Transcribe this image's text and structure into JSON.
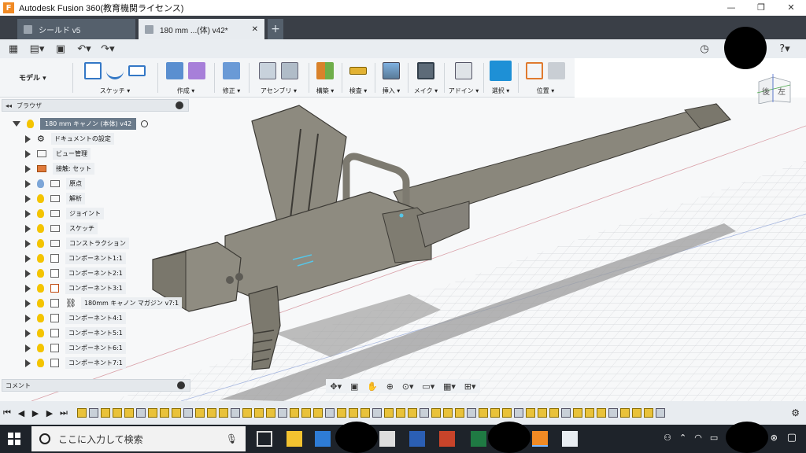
{
  "window": {
    "title": "Autodesk Fusion 360(教育機関ライセンス)",
    "controls": [
      "—",
      "❐",
      "✕"
    ]
  },
  "tabs": [
    {
      "label": "シールド v5",
      "active": false
    },
    {
      "label": "180 mm ...(体) v42*",
      "active": true
    }
  ],
  "tab_close": "✕",
  "tab_add": "+",
  "ribbon": {
    "workspace": "モデル ▾",
    "groups": [
      {
        "label": "スケッチ ▾"
      },
      {
        "label": "作成 ▾"
      },
      {
        "label": "修正 ▾"
      },
      {
        "label": "アセンブリ ▾"
      },
      {
        "label": "構築 ▾"
      },
      {
        "label": "検査 ▾"
      },
      {
        "label": "挿入 ▾"
      },
      {
        "label": "メイク ▾"
      },
      {
        "label": "アドイン ▾"
      },
      {
        "label": "選択 ▾"
      },
      {
        "label": "位置 ▾"
      }
    ]
  },
  "viewcube": {
    "left_face": "後",
    "right_face": "左"
  },
  "browser": {
    "title": "ブラウザ",
    "root": "180 mm キャノン (本体) v42",
    "items": [
      {
        "label": "ドキュメントの設定",
        "type": "gear"
      },
      {
        "label": "ビュー管理",
        "type": "folder"
      },
      {
        "label": "接触: セット",
        "type": "contact"
      },
      {
        "label": "原点",
        "type": "folder"
      },
      {
        "label": "解析",
        "type": "folder"
      },
      {
        "label": "ジョイント",
        "type": "folder"
      },
      {
        "label": "スケッチ",
        "type": "folder"
      },
      {
        "label": "コンストラクション",
        "type": "folder"
      },
      {
        "label": "コンポーネント1:1",
        "type": "component"
      },
      {
        "label": "コンポーネント2:1",
        "type": "component"
      },
      {
        "label": "コンポーネント3:1",
        "type": "component"
      },
      {
        "label": "180mm キャノン マガジン v7:1",
        "type": "link"
      },
      {
        "label": "コンポーネント4:1",
        "type": "component"
      },
      {
        "label": "コンポーネント5:1",
        "type": "component"
      },
      {
        "label": "コンポーネント6:1",
        "type": "component"
      },
      {
        "label": "コンポーネント7:1",
        "type": "component"
      }
    ]
  },
  "comment_bar": {
    "label": "コメント"
  },
  "timeline": {
    "controls": [
      "⏮",
      "◀",
      "▶",
      "▶",
      "⏭"
    ],
    "item_count": 50
  },
  "taskbar": {
    "search_placeholder": "ここに入力して検索",
    "icons": [
      "start-icon",
      "task-view-icon",
      "file-explorer-icon",
      "store-icon",
      "mail-icon",
      "word-icon",
      "powerpoint-icon",
      "excel-icon",
      "fusion-icon",
      "photos-icon"
    ]
  },
  "colors": {
    "tab_bar": "#3a3f47",
    "ribbon": "#f3f5f7",
    "select_accent": "#1e90d6",
    "model_gray": "#8d8a7f",
    "taskbar": "#1e232a"
  }
}
